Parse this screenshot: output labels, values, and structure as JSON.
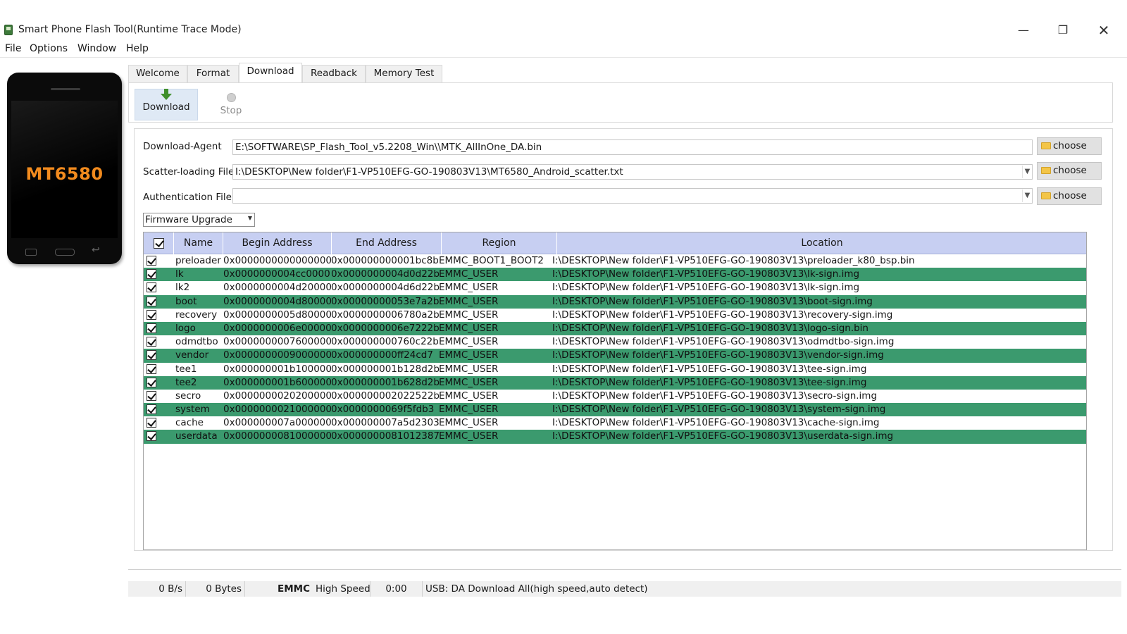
{
  "window": {
    "title": "Smart Phone Flash Tool(Runtime Trace Mode)",
    "controls": {
      "minimize": "—",
      "maximize": "❐",
      "close": "✕"
    }
  },
  "menu": [
    "File",
    "Options",
    "Window",
    "Help"
  ],
  "phone": {
    "model": "MT6580",
    "brand_color": "#f28b1e"
  },
  "tabs": [
    {
      "label": "Welcome",
      "active": false
    },
    {
      "label": "Format",
      "active": false
    },
    {
      "label": "Download",
      "active": true
    },
    {
      "label": "Readback",
      "active": false
    },
    {
      "label": "Memory Test",
      "active": false
    }
  ],
  "toolbar": {
    "download_label": "Download",
    "download_icon": "green-down-arrow-icon",
    "stop_label": "Stop",
    "stop_icon": "stop-circle-icon"
  },
  "fields": {
    "download_agent": {
      "label": "Download-Agent",
      "value": "E:\\SOFTWARE\\SP_Flash_Tool_v5.2208_Win\\\\MTK_AllInOne_DA.bin"
    },
    "scatter": {
      "label": "Scatter-loading File",
      "value": "I:\\DESKTOP\\New folder\\F1-VP510EFG-GO-190803V13\\MT6580_Android_scatter.txt"
    },
    "auth": {
      "label": "Authentication File",
      "value": ""
    },
    "choose_label": "choose"
  },
  "mode_select": {
    "value": "Firmware Upgrade"
  },
  "table": {
    "columns": [
      "Name",
      "Begin Address",
      "End Address",
      "Region",
      "Location"
    ],
    "row_highlight_color": "#3b9a6e",
    "rows": [
      {
        "checked": true,
        "name": "preloader",
        "begin": "0x0000000000000000",
        "end": "0x000000000001bc8b",
        "region": "EMMC_BOOT1_BOOT2",
        "location": "I:\\DESKTOP\\New folder\\F1-VP510EFG-GO-190803V13\\preloader_k80_bsp.bin"
      },
      {
        "checked": true,
        "name": "lk",
        "begin": "0x0000000004cc0000",
        "end": "0x0000000004d0d22b",
        "region": "EMMC_USER",
        "location": "I:\\DESKTOP\\New folder\\F1-VP510EFG-GO-190803V13\\lk-sign.img"
      },
      {
        "checked": true,
        "name": "lk2",
        "begin": "0x0000000004d20000",
        "end": "0x0000000004d6d22b",
        "region": "EMMC_USER",
        "location": "I:\\DESKTOP\\New folder\\F1-VP510EFG-GO-190803V13\\lk-sign.img"
      },
      {
        "checked": true,
        "name": "boot",
        "begin": "0x0000000004d80000",
        "end": "0x00000000053e7a2b",
        "region": "EMMC_USER",
        "location": "I:\\DESKTOP\\New folder\\F1-VP510EFG-GO-190803V13\\boot-sign.img"
      },
      {
        "checked": true,
        "name": "recovery",
        "begin": "0x0000000005d80000",
        "end": "0x0000000006780a2b",
        "region": "EMMC_USER",
        "location": "I:\\DESKTOP\\New folder\\F1-VP510EFG-GO-190803V13\\recovery-sign.img"
      },
      {
        "checked": true,
        "name": "logo",
        "begin": "0x0000000006e00000",
        "end": "0x0000000006e7222b",
        "region": "EMMC_USER",
        "location": "I:\\DESKTOP\\New folder\\F1-VP510EFG-GO-190803V13\\logo-sign.bin"
      },
      {
        "checked": true,
        "name": "odmdtbo",
        "begin": "0x0000000007600000",
        "end": "0x000000000760c22b",
        "region": "EMMC_USER",
        "location": "I:\\DESKTOP\\New folder\\F1-VP510EFG-GO-190803V13\\odmdtbo-sign.img"
      },
      {
        "checked": true,
        "name": "vendor",
        "begin": "0x0000000009000000",
        "end": "0x000000000ff24cd7",
        "region": "EMMC_USER",
        "location": "I:\\DESKTOP\\New folder\\F1-VP510EFG-GO-190803V13\\vendor-sign.img"
      },
      {
        "checked": true,
        "name": "tee1",
        "begin": "0x000000001b100000",
        "end": "0x000000001b128d2b",
        "region": "EMMC_USER",
        "location": "I:\\DESKTOP\\New folder\\F1-VP510EFG-GO-190803V13\\tee-sign.img"
      },
      {
        "checked": true,
        "name": "tee2",
        "begin": "0x000000001b600000",
        "end": "0x000000001b628d2b",
        "region": "EMMC_USER",
        "location": "I:\\DESKTOP\\New folder\\F1-VP510EFG-GO-190803V13\\tee-sign.img"
      },
      {
        "checked": true,
        "name": "secro",
        "begin": "0x0000000020200000",
        "end": "0x000000002022522b",
        "region": "EMMC_USER",
        "location": "I:\\DESKTOP\\New folder\\F1-VP510EFG-GO-190803V13\\secro-sign.img"
      },
      {
        "checked": true,
        "name": "system",
        "begin": "0x0000000021000000",
        "end": "0x0000000069f5fdb3",
        "region": "EMMC_USER",
        "location": "I:\\DESKTOP\\New folder\\F1-VP510EFG-GO-190803V13\\system-sign.img"
      },
      {
        "checked": true,
        "name": "cache",
        "begin": "0x000000007a000000",
        "end": "0x000000007a5d2303",
        "region": "EMMC_USER",
        "location": "I:\\DESKTOP\\New folder\\F1-VP510EFG-GO-190803V13\\cache-sign.img"
      },
      {
        "checked": true,
        "name": "userdata",
        "begin": "0x0000000081000000",
        "end": "0x0000000081012387",
        "region": "EMMC_USER",
        "location": "I:\\DESKTOP\\New folder\\F1-VP510EFG-GO-190803V13\\userdata-sign.img"
      }
    ]
  },
  "status": {
    "speed": "0 B/s",
    "bytes": "0 Bytes",
    "storage": "EMMC",
    "mode": "High Speed",
    "time": "0:00",
    "usb": "USB: DA Download All(high speed,auto detect)"
  }
}
